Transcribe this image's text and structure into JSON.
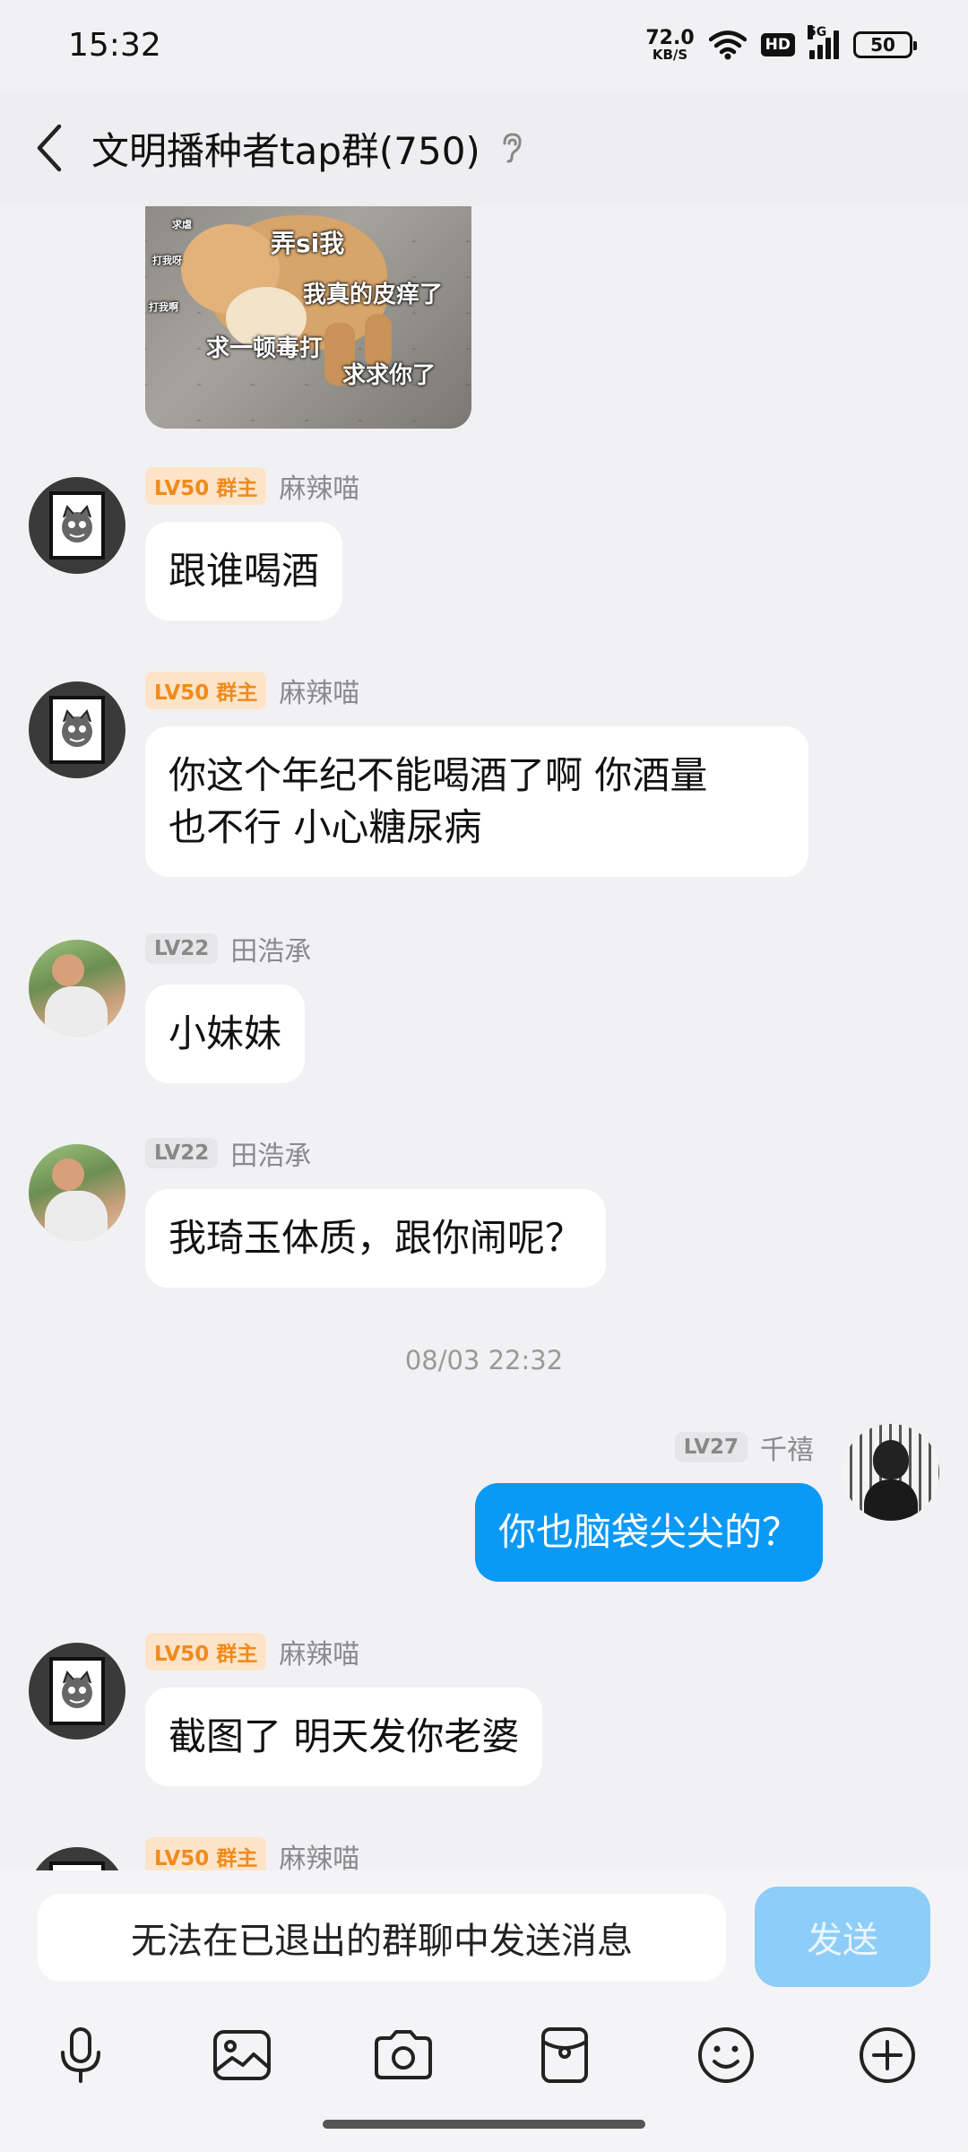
{
  "status_bar": {
    "time": "15:32",
    "net_speed_value": "72.0",
    "net_speed_unit": "KB/S",
    "hd_label": "HD",
    "network": "5G",
    "battery": "50"
  },
  "header": {
    "title": "文明播种者tap群(750)",
    "back_icon": "chevron-left-icon",
    "help_icon": "ear-help-icon"
  },
  "sticker": {
    "lines": [
      "弄si我",
      "我真的皮痒了",
      "求一顿毒打",
      "求求你了"
    ],
    "small_lines": [
      "求虐",
      "打我呀",
      "打我啊"
    ]
  },
  "messages": [
    {
      "level": "LV50",
      "role": "群主",
      "sender": "麻辣喵",
      "text": "跟谁喝酒"
    },
    {
      "level": "LV50",
      "role": "群主",
      "sender": "麻辣喵",
      "text": "你这个年纪不能喝酒了啊 你酒量\n也不行 小心糖尿病"
    },
    {
      "level": "LV22",
      "role": "",
      "sender": "田浩承",
      "text": "小妹妹"
    },
    {
      "level": "LV22",
      "role": "",
      "sender": "田浩承",
      "text": "我琦玉体质，跟你闹呢？"
    },
    {
      "level": "LV27",
      "role": "",
      "sender": "千禧",
      "text": "你也脑袋尖尖的？"
    },
    {
      "level": "LV50",
      "role": "群主",
      "sender": "麻辣喵",
      "text": "截图了 明天发你老婆"
    },
    {
      "level": "LV50",
      "role": "群主",
      "sender": "麻辣喵",
      "text": ""
    }
  ],
  "timestamp": "08/03 22:32",
  "input": {
    "placeholder": "无法在已退出的群聊中发送消息",
    "send_label": "发送"
  },
  "toolbar_icons": [
    "microphone-icon",
    "image-icon",
    "camera-icon",
    "red-packet-icon",
    "emoji-icon",
    "plus-icon"
  ],
  "colors": {
    "self_bubble": "#0a99f5",
    "owner_badge_bg": "#fde4c8",
    "owner_badge_text": "#f08a1c",
    "send_button_disabled": "#8ecdf7"
  }
}
